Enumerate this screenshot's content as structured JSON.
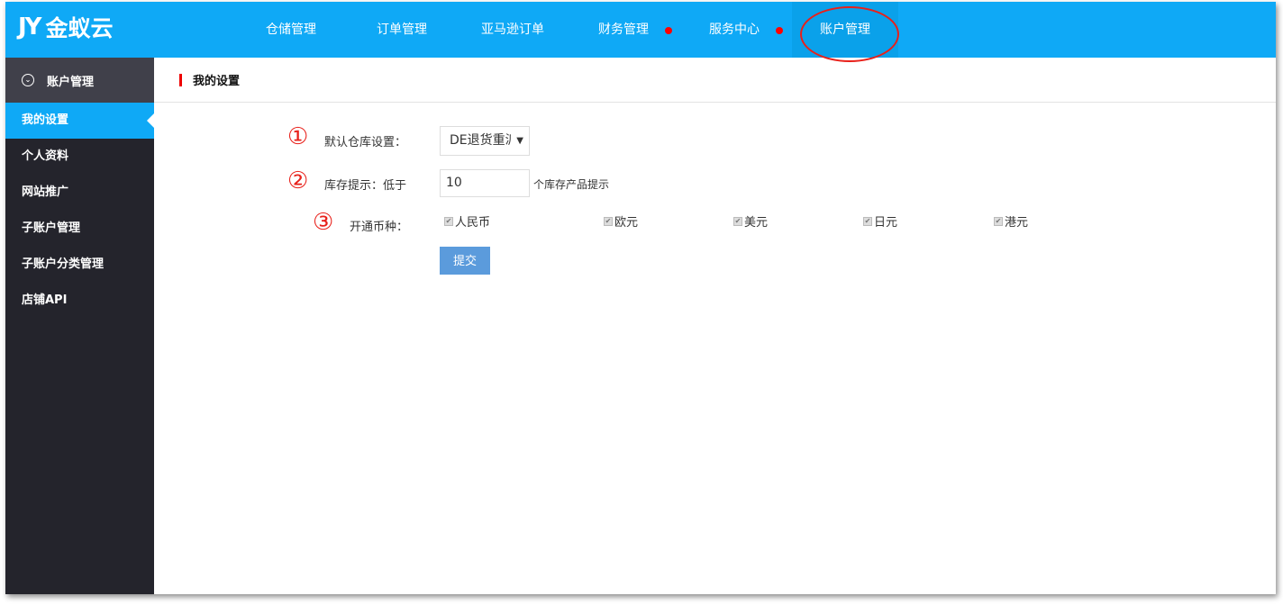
{
  "logo": {
    "mark": "JY",
    "name": "金蚁云"
  },
  "nav": [
    {
      "label": "仓储管理"
    },
    {
      "label": "订单管理"
    },
    {
      "label": "亚马逊订单"
    },
    {
      "label": "财务管理",
      "dot": true
    },
    {
      "label": "服务中心",
      "dot": true
    },
    {
      "label": "账户管理",
      "active": true
    }
  ],
  "sidebar": {
    "header": "账户管理",
    "items": [
      {
        "label": "我的设置",
        "active": true
      },
      {
        "label": "个人资料"
      },
      {
        "label": "网站推广"
      },
      {
        "label": "子账户管理"
      },
      {
        "label": "子账户分类管理"
      },
      {
        "label": "店铺API"
      }
    ]
  },
  "page": {
    "title": "我的设置"
  },
  "form": {
    "annotations": [
      "①",
      "②",
      "③"
    ],
    "warehouse_label": "默认仓库设置：",
    "warehouse_value": "DE退货重派",
    "stock_label": "库存提示：低于",
    "stock_value": "10",
    "stock_suffix": "个库存产品提示",
    "currency_label": "开通币种：",
    "currencies": [
      {
        "label": "人民币",
        "checked": true
      },
      {
        "label": "欧元",
        "checked": true
      },
      {
        "label": "美元",
        "checked": true
      },
      {
        "label": "日元",
        "checked": true
      },
      {
        "label": "港元",
        "checked": true
      }
    ],
    "submit": "提交"
  },
  "colors": {
    "brand": "#0fa9f6",
    "sidebar": "#24242c",
    "annotation": "#e8201a",
    "button": "#5b9bdc"
  }
}
